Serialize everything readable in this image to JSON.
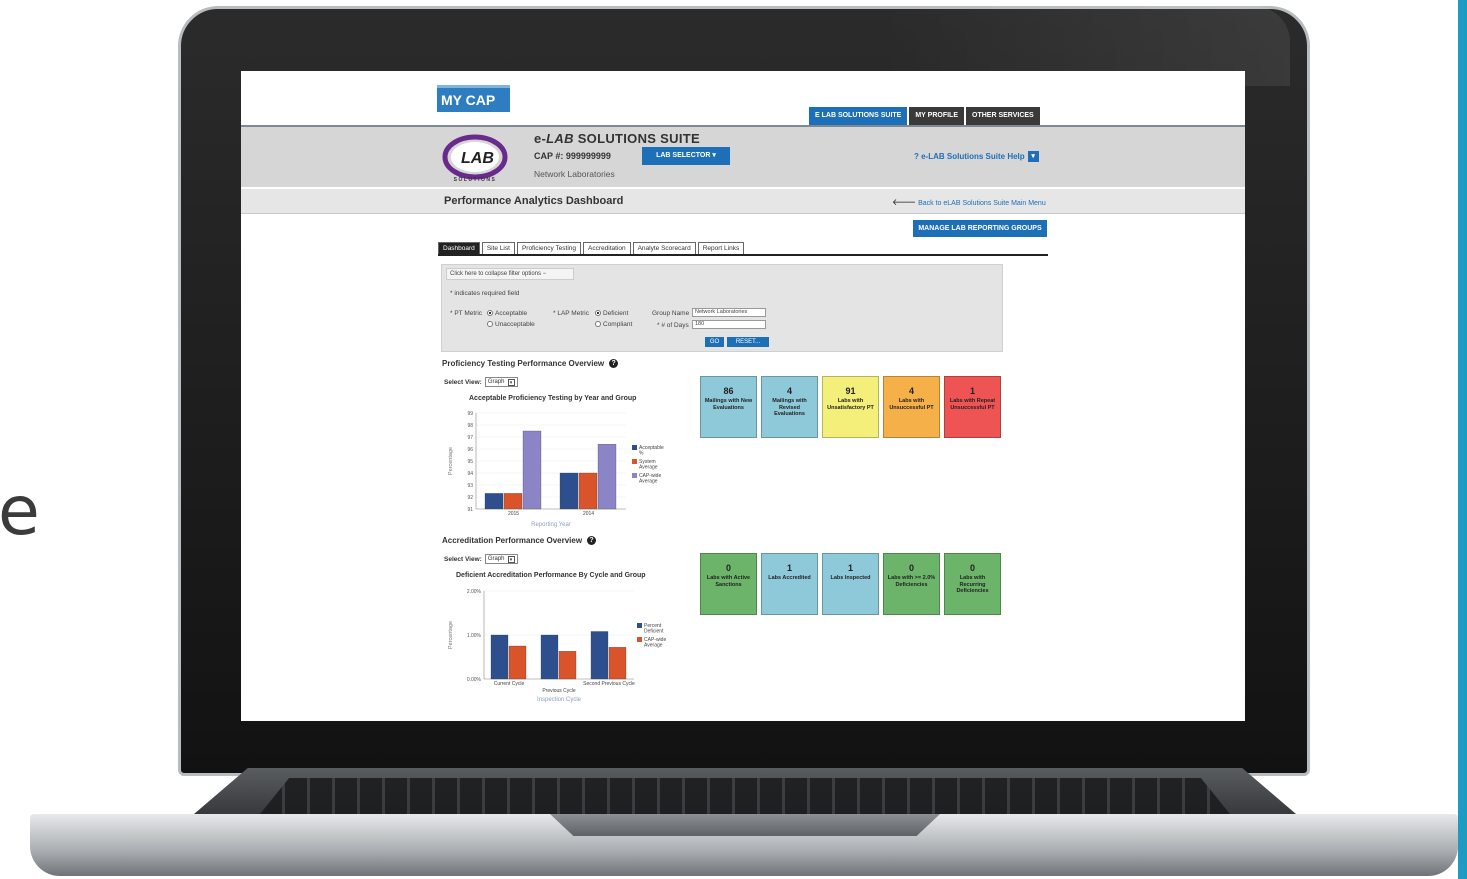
{
  "side_text": "e",
  "colors": {
    "accent_bar": "#1e9bc2",
    "brand_blue": "#1d6fb8",
    "tile_blue": "#8ec9d9",
    "tile_yellow": "#f4ee7b",
    "tile_orange": "#f5b04a",
    "tile_red": "#ee5454",
    "tile_green": "#6bb46a",
    "bar_blue": "#2d4f8e",
    "bar_red": "#d9532b",
    "bar_purple": "#8b84c6"
  },
  "header": {
    "my_cap": "MY CAP",
    "nav": [
      "E LAB SOLUTIONS SUITE",
      "MY PROFILE",
      "OTHER SERVICES"
    ],
    "logo_text": "LAB",
    "logo_arc_text": "SOLUTIONS",
    "suite_title_prefix": "e-",
    "suite_title_italic": "LAB",
    "suite_title_rest": " SOLUTIONS SUITE",
    "cap_number": "CAP #: 999999999",
    "lab_selector": "LAB SELECTOR",
    "lab_name": "Network Laboratories",
    "help": "? e-LAB Solutions Suite Help"
  },
  "page": {
    "title": "Performance Analytics Dashboard",
    "back_link": "Back to eLAB Solutions Suite Main Menu",
    "manage_button": "MANAGE LAB REPORTING GROUPS",
    "tabs": [
      "Dashboard",
      "Site List",
      "Proficiency Testing",
      "Accreditation",
      "Analyte Scorecard",
      "Report Links"
    ]
  },
  "filter": {
    "collapse": "Click here to collapse filter options",
    "required_note": "* indicates required field",
    "pt_metric_label": "* PT Metric",
    "pt_options": [
      "Acceptable",
      "Unacceptable"
    ],
    "lap_metric_label": "* LAP Metric",
    "lap_options": [
      "Deficient",
      "Compliant"
    ],
    "group_name_label": "Group Name",
    "group_name_value": "Network Laboratories",
    "days_label": "* # of Days",
    "days_value": "180",
    "go": "GO",
    "reset": "RESET"
  },
  "pt_section": {
    "title": "Proficiency Testing Performance Overview",
    "select_view_label": "Select View:",
    "select_view_value": "Graph",
    "tiles": [
      {
        "value": "86",
        "label": "Mailings with New Evaluations",
        "color": "#8ec9d9"
      },
      {
        "value": "4",
        "label": "Mailings with Revised Evaluations",
        "color": "#8ec9d9"
      },
      {
        "value": "91",
        "label": "Labs with Unsatisfactory PT",
        "color": "#f4ee7b"
      },
      {
        "value": "4",
        "label": "Labs with Unsuccessful PT",
        "color": "#f5b04a"
      },
      {
        "value": "1",
        "label": "Labs with Repeat Unsuccessful PT",
        "color": "#ee5454"
      }
    ]
  },
  "acc_section": {
    "title": "Accreditation Performance Overview",
    "select_view_label": "Select View:",
    "select_view_value": "Graph",
    "tiles": [
      {
        "value": "0",
        "label": "Labs with Active Sanctions",
        "color": "#6bb46a"
      },
      {
        "value": "1",
        "label": "Labs Accredited",
        "color": "#8ec9d9"
      },
      {
        "value": "1",
        "label": "Labs Inspected",
        "color": "#8ec9d9"
      },
      {
        "value": "0",
        "label": "Labs with >= 2.0% Deficiencies",
        "color": "#6bb46a"
      },
      {
        "value": "0",
        "label": "Labs with Recurring Deficiencies",
        "color": "#6bb46a"
      }
    ]
  },
  "chart_data": [
    {
      "type": "bar",
      "title": "Acceptable Proficiency Testing by Year and Group",
      "xlabel": "Reporting Year",
      "ylabel": "Percentage",
      "categories": [
        "2015",
        "2014"
      ],
      "yticks": [
        "99",
        "98",
        "97",
        "96",
        "95",
        "94",
        "93",
        "92",
        "91"
      ],
      "ylim": [
        91,
        99
      ],
      "series": [
        {
          "name": "Acceptable %",
          "legend_lines": [
            "Acceptable",
            "%"
          ],
          "color": "#2d4f8e",
          "values": [
            92.3,
            94.0
          ]
        },
        {
          "name": "System Average",
          "legend_lines": [
            "System",
            "Average"
          ],
          "color": "#d9532b",
          "values": [
            92.3,
            94.0
          ]
        },
        {
          "name": "CAP-wide Average",
          "legend_lines": [
            "CAP-wide",
            "Average"
          ],
          "color": "#8b84c6",
          "values": [
            97.5,
            96.4
          ]
        }
      ],
      "legend": "right"
    },
    {
      "type": "bar",
      "title": "Deficient Accreditation Performance By Cycle and Group",
      "xlabel": "Inspection Cycle",
      "ylabel": "Percentage",
      "categories": [
        "Current Cycle",
        "Previous Cycle",
        "Second Previous Cycle"
      ],
      "yticks": [
        "2.00%",
        "1.00%",
        "0.00%"
      ],
      "ylim": [
        0,
        2
      ],
      "series": [
        {
          "name": "Percent Deficient",
          "legend_lines": [
            "Percent",
            "Deficient"
          ],
          "color": "#2d4f8e",
          "values": [
            1.0,
            1.0,
            1.08
          ]
        },
        {
          "name": "CAP-wide Average",
          "legend_lines": [
            "CAP-wide",
            "Average"
          ],
          "color": "#d9532b",
          "values": [
            0.75,
            0.63,
            0.72
          ]
        }
      ],
      "legend": "right"
    }
  ]
}
